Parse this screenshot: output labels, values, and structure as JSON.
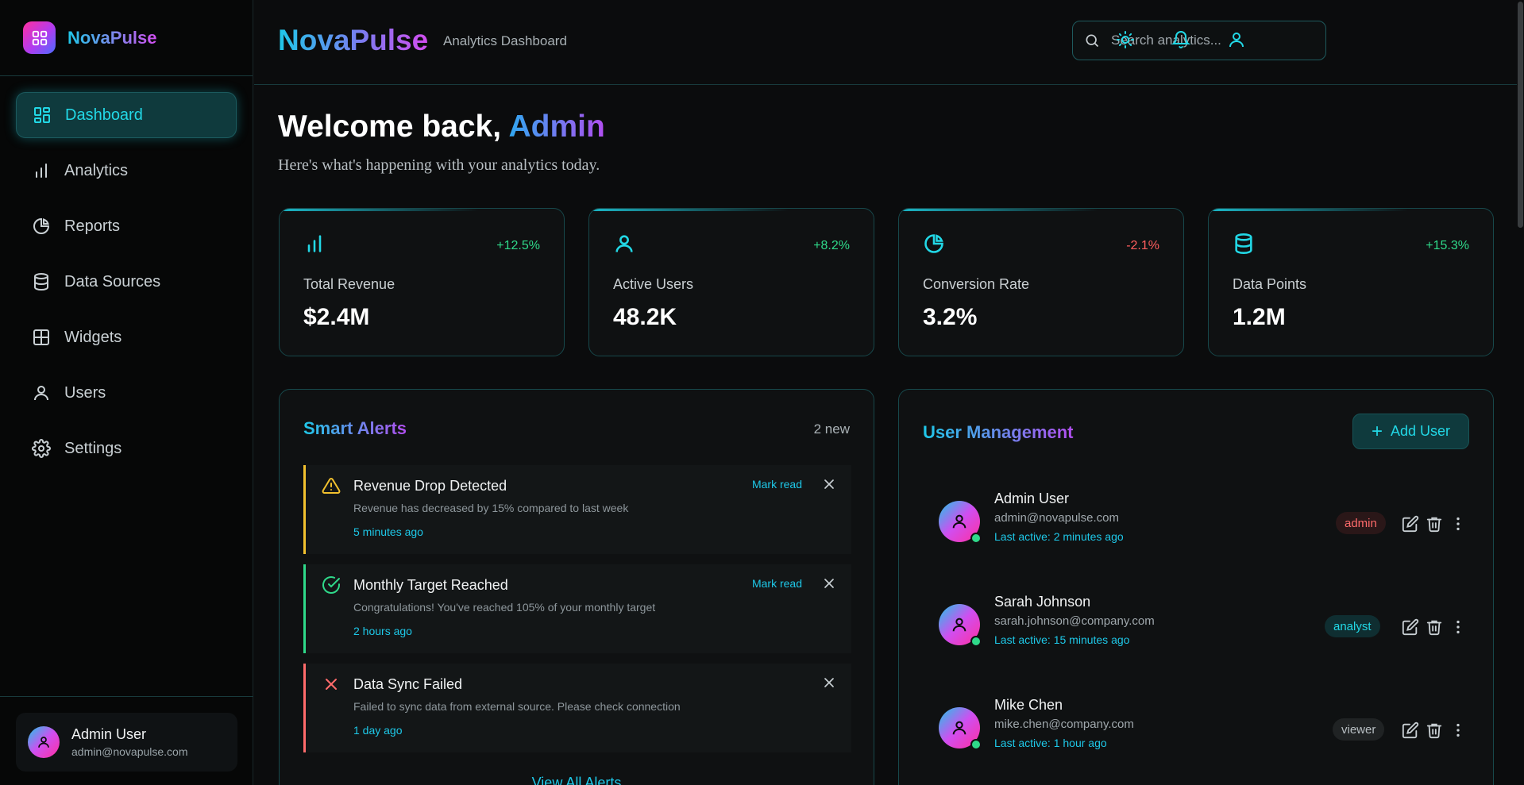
{
  "sidebar": {
    "brand": "NovaPulse",
    "items": [
      {
        "label": "Dashboard",
        "icon": "dashboard-icon",
        "active": true
      },
      {
        "label": "Analytics",
        "icon": "bar-chart-icon"
      },
      {
        "label": "Reports",
        "icon": "pie-chart-icon"
      },
      {
        "label": "Data Sources",
        "icon": "database-icon"
      },
      {
        "label": "Widgets",
        "icon": "widgets-icon"
      },
      {
        "label": "Users",
        "icon": "user-icon"
      },
      {
        "label": "Settings",
        "icon": "gear-icon"
      }
    ],
    "user": {
      "name": "Admin User",
      "email": "admin@novapulse.com"
    }
  },
  "header": {
    "brand": "NovaPulse",
    "subtitle": "Analytics Dashboard",
    "search_placeholder": "Search analytics..."
  },
  "welcome": {
    "prefix": "Welcome back, ",
    "name": "Admin",
    "subtitle": "Here's what's happening with your analytics today."
  },
  "stats": [
    {
      "label": "Total Revenue",
      "value": "$2.4M",
      "change": "+12.5%",
      "trend": "up",
      "icon": "bar-chart-icon"
    },
    {
      "label": "Active Users",
      "value": "48.2K",
      "change": "+8.2%",
      "trend": "up",
      "icon": "user-icon"
    },
    {
      "label": "Conversion Rate",
      "value": "3.2%",
      "change": "-2.1%",
      "trend": "down",
      "icon": "pie-chart-icon"
    },
    {
      "label": "Data Points",
      "value": "1.2M",
      "change": "+15.3%",
      "trend": "up",
      "icon": "database-icon"
    }
  ],
  "alerts": {
    "title": "Smart Alerts",
    "count": "2 new",
    "mark_read_label": "Mark read",
    "view_all": "View All Alerts",
    "items": [
      {
        "title": "Revenue Drop Detected",
        "message": "Revenue has decreased by 15% compared to last week",
        "time": "5 minutes ago",
        "type": "warning",
        "color": "#f2c12e"
      },
      {
        "title": "Monthly Target Reached",
        "message": "Congratulations! You've reached 105% of your monthly target",
        "time": "2 hours ago",
        "type": "success",
        "color": "#2fd98a"
      },
      {
        "title": "Data Sync Failed",
        "message": "Failed to sync data from external source. Please check connection",
        "time": "1 day ago",
        "type": "error",
        "color": "#ff6b6b"
      }
    ]
  },
  "users": {
    "title": "User Management",
    "add_label": "Add User",
    "items": [
      {
        "name": "Admin User",
        "email": "admin@novapulse.com",
        "last_active": "Last active: 2 minutes ago",
        "role": "admin"
      },
      {
        "name": "Sarah Johnson",
        "email": "sarah.johnson@company.com",
        "last_active": "Last active: 15 minutes ago",
        "role": "analyst"
      },
      {
        "name": "Mike Chen",
        "email": "mike.chen@company.com",
        "last_active": "Last active: 1 hour ago",
        "role": "viewer"
      }
    ]
  },
  "colors": {
    "accent": "#22d8e6",
    "positive": "#2fd98a",
    "negative": "#ff5e5e"
  }
}
